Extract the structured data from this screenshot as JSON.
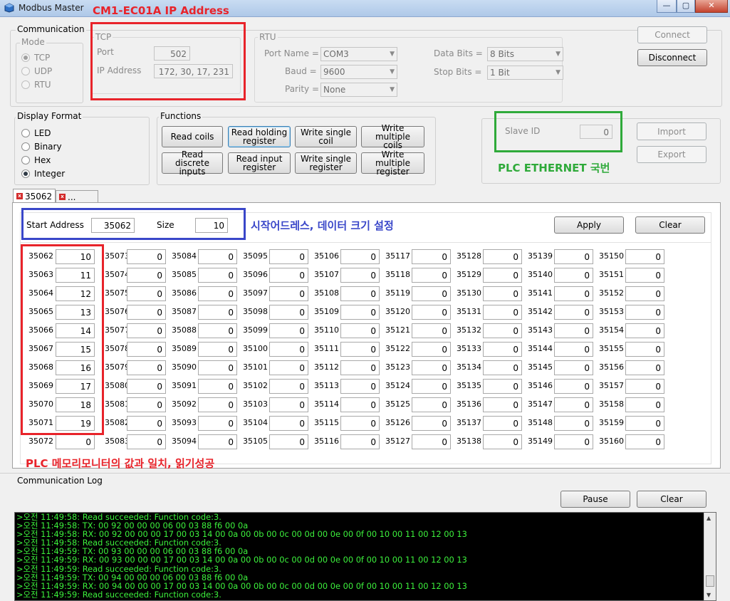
{
  "window": {
    "title": "Modbus Master",
    "minimize_glyph": "—",
    "maximize_glyph": "▢",
    "close_glyph": "✕"
  },
  "communication": {
    "label": "Communication",
    "mode": {
      "label": "Mode",
      "options": [
        "TCP",
        "UDP",
        "RTU"
      ],
      "selected": "TCP"
    },
    "tcp": {
      "label": "TCP",
      "port_label": "Port",
      "port_value": "502",
      "ip_label": "IP Address",
      "ip_value": "172, 30, 17, 231"
    },
    "rtu": {
      "label": "RTU",
      "port_name_label": "Port Name =",
      "port_name_value": "COM3",
      "baud_label": "Baud =",
      "baud_value": "9600",
      "parity_label": "Parity =",
      "parity_value": "None",
      "data_bits_label": "Data Bits =",
      "data_bits_value": "8 Bits",
      "stop_bits_label": "Stop Bits =",
      "stop_bits_value": "1 Bit"
    },
    "connect_label": "Connect",
    "disconnect_label": "Disconnect"
  },
  "display_format": {
    "label": "Display Format",
    "options": [
      "LED",
      "Binary",
      "Hex",
      "Integer"
    ],
    "selected": "Integer"
  },
  "functions": {
    "label": "Functions",
    "buttons": [
      [
        "Read coils"
      ],
      [
        "Read holding",
        "register"
      ],
      [
        "Write single",
        "coil"
      ],
      [
        "Write multiple",
        "coils"
      ],
      [
        "Read discrete",
        "inputs"
      ],
      [
        "Read input",
        "register"
      ],
      [
        "Write single",
        "register"
      ],
      [
        "Write multiple",
        "register"
      ]
    ]
  },
  "slave": {
    "label": "Slave ID",
    "value": "0",
    "import_label": "Import",
    "export_label": "Export"
  },
  "tabs": [
    {
      "label": "35062",
      "icon": "close-x-icon"
    },
    {
      "label": "...",
      "icon": "close-x-icon"
    }
  ],
  "register_panel": {
    "start_address_label": "Start Address",
    "start_address_value": "35062",
    "size_label": "Size",
    "size_value": "10",
    "apply_label": "Apply",
    "clear_label": "Clear",
    "columns": [
      {
        "start": 35062,
        "values": [
          "10",
          "11",
          "12",
          "13",
          "14",
          "15",
          "16",
          "17",
          "18",
          "19",
          "0"
        ]
      },
      {
        "start": 35073,
        "values": [
          "0",
          "0",
          "0",
          "0",
          "0",
          "0",
          "0",
          "0",
          "0",
          "0",
          "0"
        ]
      },
      {
        "start": 35084,
        "values": [
          "0",
          "0",
          "0",
          "0",
          "0",
          "0",
          "0",
          "0",
          "0",
          "0",
          "0"
        ]
      },
      {
        "start": 35095,
        "values": [
          "0",
          "0",
          "0",
          "0",
          "0",
          "0",
          "0",
          "0",
          "0",
          "0",
          "0"
        ]
      },
      {
        "start": 35106,
        "values": [
          "0",
          "0",
          "0",
          "0",
          "0",
          "0",
          "0",
          "0",
          "0",
          "0",
          "0"
        ]
      },
      {
        "start": 35117,
        "values": [
          "0",
          "0",
          "0",
          "0",
          "0",
          "0",
          "0",
          "0",
          "0",
          "0",
          "0"
        ]
      },
      {
        "start": 35128,
        "values": [
          "0",
          "0",
          "0",
          "0",
          "0",
          "0",
          "0",
          "0",
          "0",
          "0",
          "0"
        ]
      },
      {
        "start": 35139,
        "values": [
          "0",
          "0",
          "0",
          "0",
          "0",
          "0",
          "0",
          "0",
          "0",
          "0",
          "0"
        ]
      },
      {
        "start": 35150,
        "values": [
          "0",
          "0",
          "0",
          "0",
          "0",
          "0",
          "0",
          "0",
          "0",
          "0",
          "0"
        ]
      }
    ]
  },
  "communication_log": {
    "label": "Communication Log",
    "pause_label": "Pause",
    "clear_label": "Clear",
    "lines": [
      ">오전 11:49:58: Read succeeded: Function code:3.",
      ">오전 11:49:58: TX: 00 92 00 00 00 06 00 03 88 f6 00 0a",
      ">오전 11:49:58: RX: 00 92 00 00 00 17 00 03 14 00 0a 00 0b 00 0c 00 0d 00 0e 00 0f 00 10 00 11 00 12 00 13",
      ">오전 11:49:58: Read succeeded: Function code:3.",
      ">오전 11:49:59: TX: 00 93 00 00 00 06 00 03 88 f6 00 0a",
      ">오전 11:49:59: RX: 00 93 00 00 00 17 00 03 14 00 0a 00 0b 00 0c 00 0d 00 0e 00 0f 00 10 00 11 00 12 00 13",
      ">오전 11:49:59: Read succeeded: Function code:3.",
      ">오전 11:49:59: TX: 00 94 00 00 00 06 00 03 88 f6 00 0a",
      ">오전 11:49:59: RX: 00 94 00 00 00 17 00 03 14 00 0a 00 0b 00 0c 00 0d 00 0e 00 0f 00 10 00 11 00 12 00 13",
      ">오전 11:49:59: Read succeeded: Function code:3."
    ]
  },
  "annotations": {
    "ip_address": "CM1-EC01A IP Address",
    "plc_station": "PLC ETHERNET 국번",
    "start_size": "시작어드레스, 데이터 크기 설정",
    "memory_match": "PLC 메모리모니터의 값과 일치, 읽기성공"
  },
  "colors": {
    "annotation_red": "#e8232a",
    "annotation_green": "#2faa3a",
    "annotation_blue": "#3a47c9",
    "log_text": "#3cf03c",
    "log_background": "#000000"
  }
}
